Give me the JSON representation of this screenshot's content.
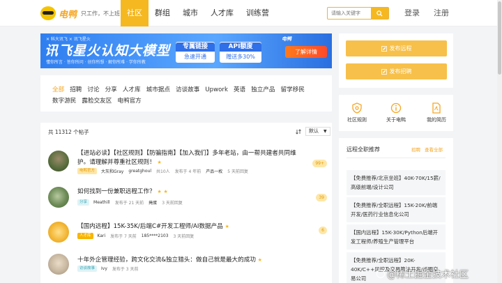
{
  "header": {
    "brand": "电鸭",
    "slogan": "只工作，不上班",
    "nav": [
      "社区",
      "群组",
      "城市",
      "人才库",
      "训练营"
    ],
    "search_placeholder": "请输入关键字",
    "login": "登录",
    "register": "注册",
    "accent": "#f5b820"
  },
  "banner": {
    "top_text": "✕ 科大讯飞 × 讯飞星火",
    "title": "讯飞星火认知大模型",
    "subtitle": "懂你所言 · 答你所问 · 创你所想 · 解你所难 · 学你所教",
    "box1_title": "专属链接",
    "box1_sub": "急速开通",
    "box2_title": "API额度",
    "box2_sub": "赠送多30%",
    "brand": "电鸭",
    "cta": "了解详情"
  },
  "tags": {
    "row1": [
      "全部",
      "招聘",
      "讨论",
      "分享",
      "人才库",
      "城市据点",
      "访谈故事",
      "Upwork",
      "英语",
      "独立产品",
      "留学移民"
    ],
    "row2": [
      "数字游民",
      "露脸交友区",
      "电鸭官方"
    ],
    "active": "全部"
  },
  "posts": {
    "count_text": "共 11312 个帖子",
    "sort_label": "默认",
    "items": [
      {
        "title": "【进站必读】【社区规则】【防骗指南】【加入我们】多年老站，由一帮共建者共同维护。请理解并尊重社区规则！",
        "badge": "电鸭官方",
        "badge_bg": "#fde6a8",
        "badge_fg": "#e59a00",
        "user": "大灰和Gray",
        "parts": [
          "greatghoul",
          "共10人",
          "发布于 4 年前",
          "产品一枚",
          "5 天前回复"
        ],
        "count": "99+"
      },
      {
        "title": "如何找到一份兼职远程工作？",
        "badge": "分享",
        "badge_bg": "#dff3f6",
        "badge_fg": "#3aa8b8",
        "user": "Meathill",
        "parts": [
          "发布于 21 天前",
          "掩蛋",
          "3 天前回复"
        ],
        "count": "39"
      },
      {
        "title": "【国内远程】15K-35K/后端C#开发工程师/AI数据产品",
        "badge": "人才库",
        "badge_bg": "#f7b500",
        "badge_fg": "#ffffff",
        "user": "Kari",
        "parts": [
          "发布于 7 天前",
          "185****2103",
          "3 天前回复"
        ],
        "count": "6"
      },
      {
        "title": "十年外企管理经验，跨文化交流&独立猎头：做自己就是最大的成功",
        "badge": "访谈故事",
        "badge_bg": "#dff3f6",
        "badge_fg": "#3aa8b8",
        "user": "Ivy",
        "parts": [
          "发布于 3 天前"
        ],
        "count": ""
      }
    ]
  },
  "sidebar": {
    "post_job": "发布远程",
    "post_job2": "发布招聘",
    "quick": [
      {
        "label": "社区规则",
        "icon": "shield-icon"
      },
      {
        "label": "关于电鸭",
        "icon": "info-icon"
      },
      {
        "label": "我的简历",
        "icon": "resume-icon"
      }
    ],
    "rec_title": "远程全职推荐",
    "rec_link1": "招聘",
    "rec_link2": "查看全部",
    "jobs": [
      "【免费推荐/北京坐班】40K-70K/15薪/高级前端/设计公司",
      "【免费推荐/全职远程】15K-20K/前端开发/医药行业信息化公司",
      "【国内远程】15K-30K/Python后端开发工程师/养殖生产管理平台",
      "【免费推荐/全职远程】20K-40K/C++风控及交易算法开发/币圈交易公司"
    ]
  },
  "watermark": "@稀土掘金技术社区"
}
